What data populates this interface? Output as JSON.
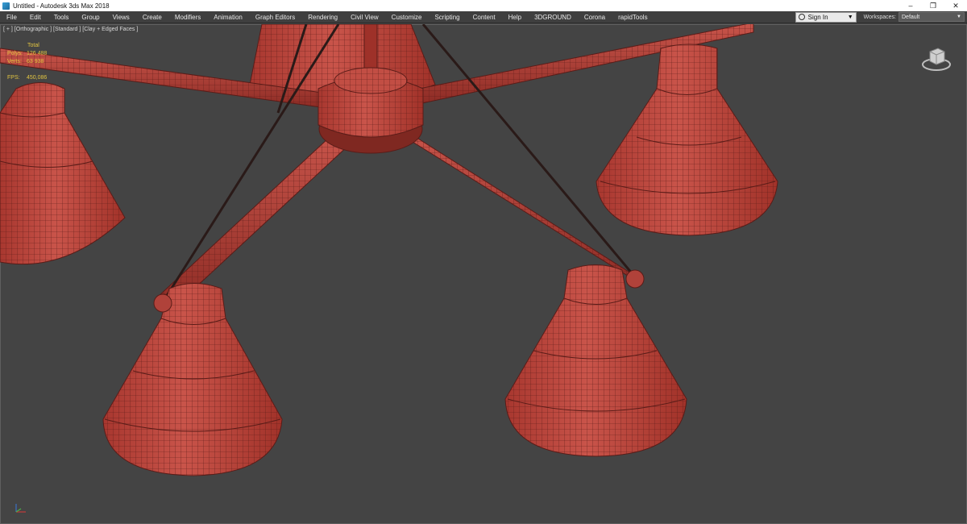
{
  "window": {
    "title": "Untitled - Autodesk 3ds Max 2018",
    "minimize_glyph": "–",
    "restore_glyph": "❐",
    "close_glyph": "✕"
  },
  "menu": {
    "items": [
      "File",
      "Edit",
      "Tools",
      "Group",
      "Views",
      "Create",
      "Modifiers",
      "Animation",
      "Graph Editors",
      "Rendering",
      "Civil View",
      "Customize",
      "Scripting",
      "Content",
      "Help",
      "3DGROUND",
      "Corona",
      "rapidTools"
    ],
    "signin_label": "Sign In",
    "workspaces_label": "Workspaces:",
    "workspace_value": "Default"
  },
  "viewport": {
    "label": "[ + ] [Orthographic ] [Standard ] [Clay + Edged Faces ]",
    "stats": {
      "total_label": "Total",
      "polys_label": "Polys:",
      "polys_value": "126 488",
      "verts_label": "Verts:",
      "verts_value": "63 938",
      "fps_label": "FPS:",
      "fps_value": "450,086"
    }
  },
  "colors": {
    "clay": "#c0463e",
    "wire": "#5a1c18",
    "viewport_bg": "#444444",
    "stats_text": "#e0c341"
  },
  "icons": {
    "app": "3ds-max-icon",
    "viewcube": "viewcube-icon",
    "axis": "axis-tripod-icon",
    "user": "user-icon"
  }
}
